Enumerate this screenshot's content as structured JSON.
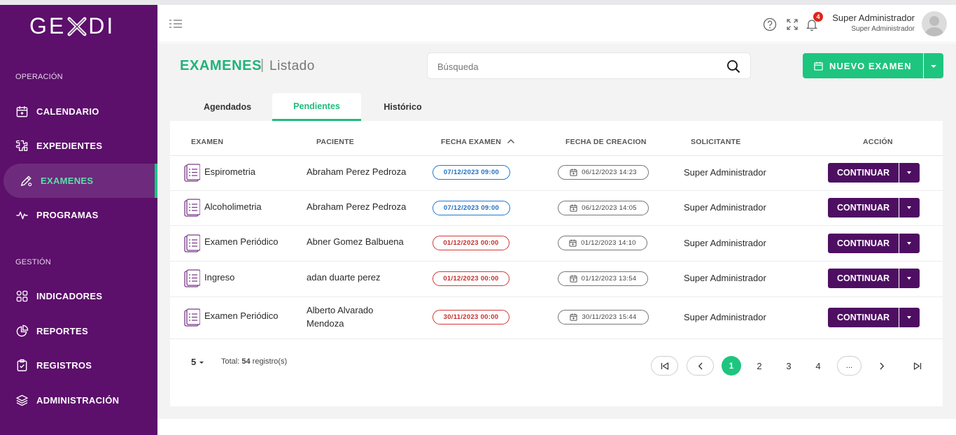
{
  "sidebar": {
    "logo": "GEXDI",
    "sections": [
      {
        "label": "OPERACIÓN"
      },
      {
        "label": "GESTIÓN"
      }
    ],
    "items": [
      {
        "label": "CALENDARIO",
        "icon": "calendar-icon"
      },
      {
        "label": "EXPEDIENTES",
        "icon": "puzzle-icon"
      },
      {
        "label": "EXAMENES",
        "icon": "pen-icon",
        "active": true
      },
      {
        "label": "PROGRAMAS",
        "icon": "pulse-icon"
      },
      {
        "label": "INDICADORES",
        "icon": "grid-icon"
      },
      {
        "label": "REPORTES",
        "icon": "pie-chart-icon"
      },
      {
        "label": "REGISTROS",
        "icon": "clipboard-icon"
      },
      {
        "label": "ADMINISTRACIÓN",
        "icon": "layers-icon"
      }
    ]
  },
  "header": {
    "notification_count": "4",
    "user_name": "Super Administrador",
    "user_role": "Super Administrador"
  },
  "page": {
    "title": "EXAMENES",
    "separator": "|",
    "subtitle": "Listado",
    "search_placeholder": "Búsqueda",
    "new_button": "NUEVO EXAMEN"
  },
  "tabs": [
    {
      "label": "Agendados"
    },
    {
      "label": "Pendientes",
      "active": true
    },
    {
      "label": "Histórico"
    }
  ],
  "table": {
    "columns": [
      "EXAMEN",
      "PACIENTE",
      "FECHA EXAMEN",
      "FECHA DE CREACION",
      "SOLICITANTE",
      "ACCIÓN"
    ],
    "rows": [
      {
        "examen": "Espirometria",
        "paciente": "Abraham Perez Pedroza",
        "fecha_examen": "07/12/2023 09:00",
        "fecha_status": "blue",
        "fecha_creacion": "06/12/2023 14:23",
        "solicitante": "Super Administrador",
        "accion": "CONTINUAR"
      },
      {
        "examen": "Alcoholimetria",
        "paciente": "Abraham Perez Pedroza",
        "fecha_examen": "07/12/2023 09:00",
        "fecha_status": "blue",
        "fecha_creacion": "06/12/2023 14:05",
        "solicitante": "Super Administrador",
        "accion": "CONTINUAR"
      },
      {
        "examen": "Examen Periódico",
        "paciente": "Abner Gomez Balbuena",
        "fecha_examen": "01/12/2023 00:00",
        "fecha_status": "red",
        "fecha_creacion": "01/12/2023 14:10",
        "solicitante": "Super Administrador",
        "accion": "CONTINUAR"
      },
      {
        "examen": "Ingreso",
        "paciente": "adan duarte perez",
        "fecha_examen": "01/12/2023 00:00",
        "fecha_status": "red",
        "fecha_creacion": "01/12/2023 13:54",
        "solicitante": "Super Administrador",
        "accion": "CONTINUAR"
      },
      {
        "examen": "Examen Periódico",
        "paciente_line1": "Alberto Alvarado",
        "paciente_line2": "Mendoza",
        "fecha_examen": "30/11/2023 00:00",
        "fecha_status": "red",
        "fecha_creacion": "30/11/2023 15:44",
        "solicitante": "Super Administrador",
        "accion": "CONTINUAR"
      }
    ]
  },
  "pagination": {
    "per_page": "5",
    "total_prefix": "Total:",
    "total_count": "54",
    "total_suffix": "registro(s)",
    "pages": [
      "1",
      "2",
      "3",
      "4"
    ],
    "current": "1",
    "ellipsis": "..."
  },
  "colors": {
    "sidebar": "#5c0f6b",
    "accent": "#1ec57e",
    "action_button": "#4e0f62",
    "badge": "#e0251b"
  }
}
